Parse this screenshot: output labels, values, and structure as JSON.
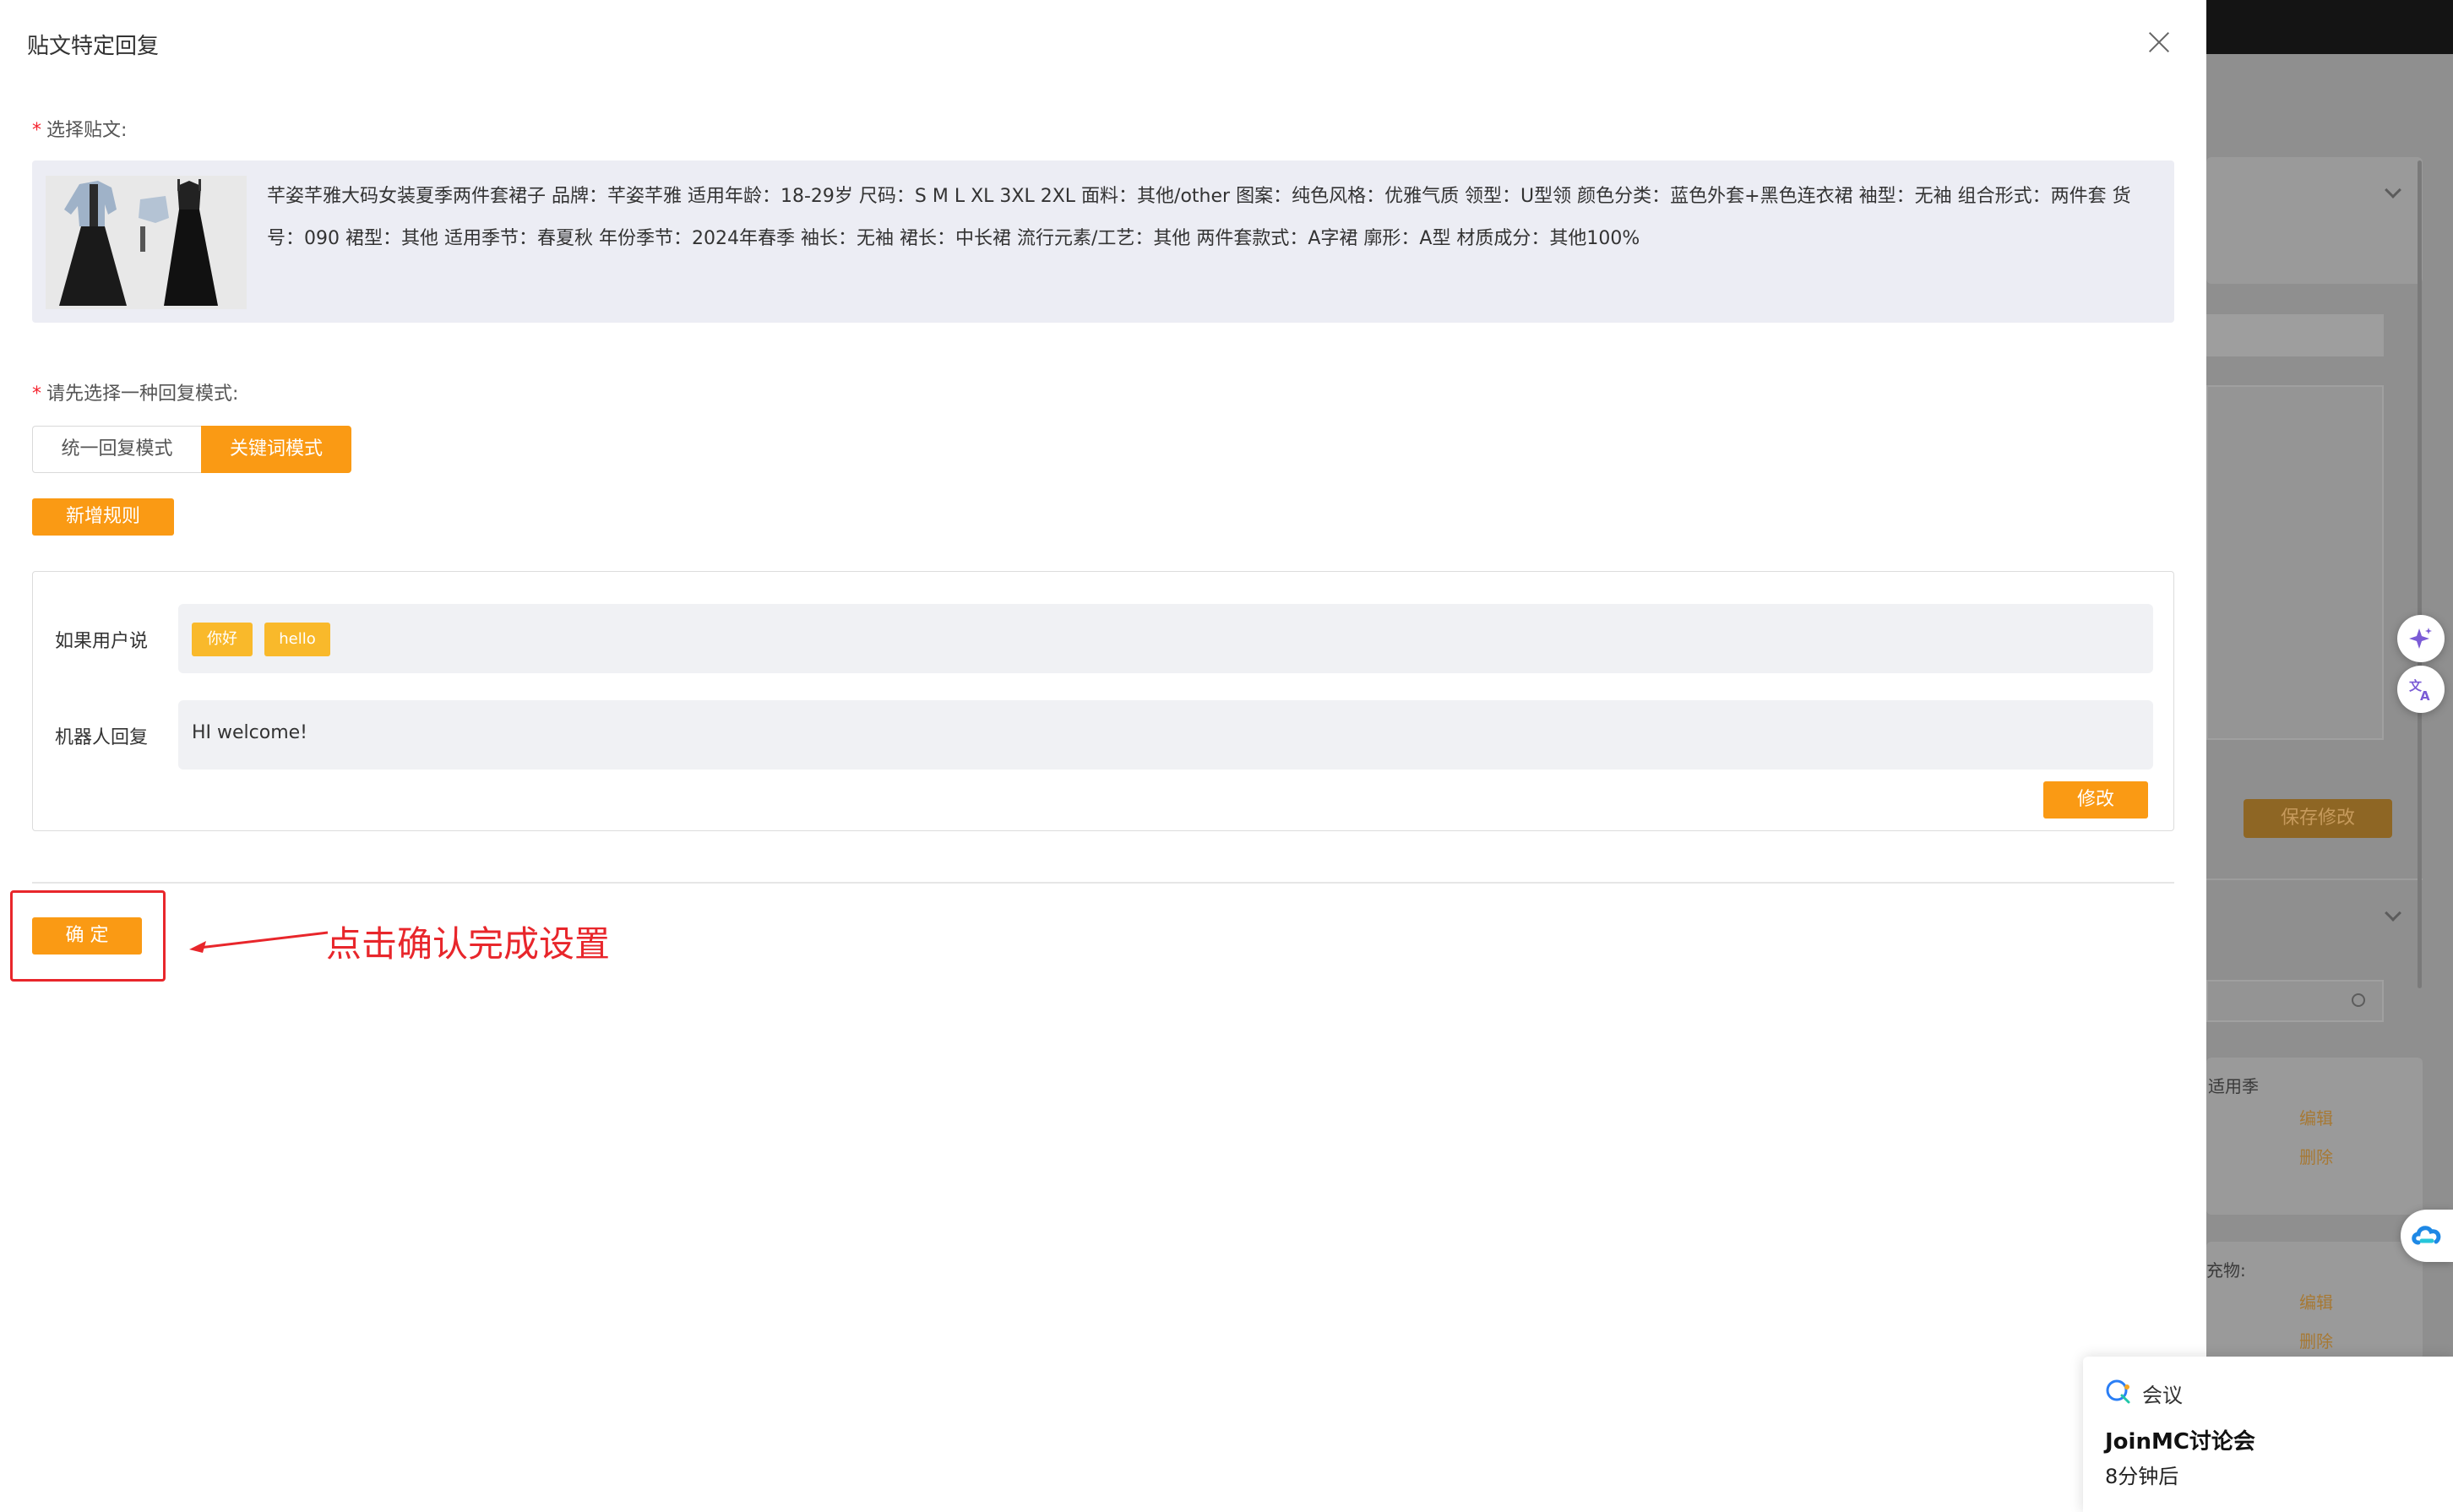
{
  "modal": {
    "title": "贴文特定回复",
    "select_post_label": "选择贴文:",
    "required_mark": "*",
    "post": {
      "description": "芊姿芊雅大码女装夏季两件套裙子 品牌：芊姿芊雅 适用年龄：18-29岁 尺码：S M L XL 3XL 2XL 面料：其他/other 图案：纯色风格：优雅气质 领型：U型领 颜色分类：蓝色外套+黑色连衣裙 袖型：无袖 组合形式：两件套 货号：090 裙型：其他 适用季节：春夏秋 年份季节：2024年春季 袖长：无袖 裙长：中长裙 流行元素/工艺：其他 两件套款式：A字裙 廓形：A型 材质成分：其他100%"
    },
    "reply_mode_label": "请先选择一种回复模式:",
    "modes": [
      {
        "label": "统一回复模式",
        "active": false
      },
      {
        "label": "关键词模式",
        "active": true
      }
    ],
    "add_rule_label": "新增规则",
    "rule": {
      "if_user_says_label": "如果用户说",
      "keywords": [
        "你好",
        "hello"
      ],
      "bot_reply_label": "机器人回复",
      "bot_reply_value": "HI welcome!",
      "edit_label": "修改"
    },
    "confirm_label": "确 定"
  },
  "annotation": {
    "text": "点击确认完成设置",
    "color": "#e8262b"
  },
  "background": {
    "save_label": "保存修改",
    "partial_text_1": "适用季",
    "partial_text_2": "充物:",
    "edit_link": "编辑",
    "delete_link": "删除"
  },
  "toast": {
    "app_name": "会议",
    "title": "JoinMC讨论会",
    "subtitle": "8分钟后"
  },
  "colors": {
    "accent": "#fa9a14",
    "tag": "#f9b92b",
    "annotation": "#e8262b"
  }
}
